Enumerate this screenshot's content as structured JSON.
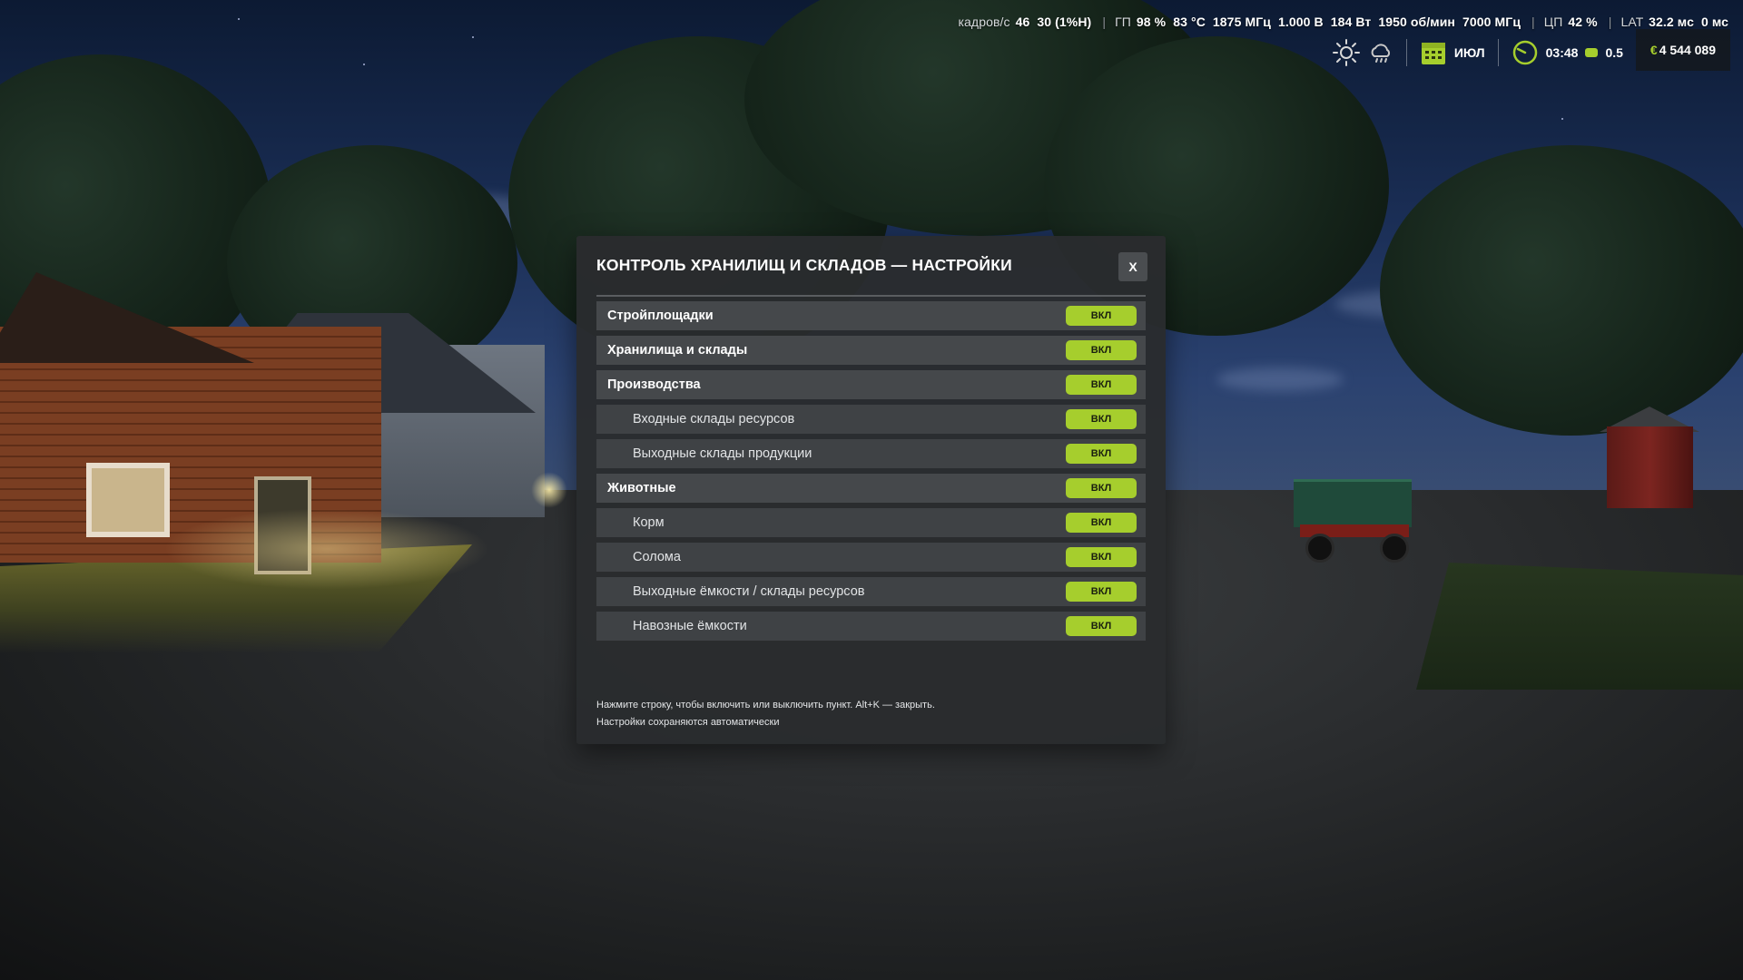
{
  "hud": {
    "stats": {
      "fps_label": "кадров/с",
      "fps_value": "46",
      "fps_limit": "30 (1%Н)",
      "gpu_label": "ГП",
      "gpu_load": "98 %",
      "gpu_temp": "83 °C",
      "gpu_clock": "1875 МГц",
      "gpu_voltage": "1.000 В",
      "gpu_power": "184 Вт",
      "gpu_fan": "1950 об/мин",
      "gpu_mem_clock": "7000 МГц",
      "cpu_label": "ЦП",
      "cpu_load": "42 %",
      "lat_label": "LAT",
      "lat_value": "32.2 мс",
      "lat_extra": "0 мс"
    },
    "month": "ИЮЛ",
    "time": "03:48",
    "time_scale": "0.5",
    "money_symbol": "€",
    "money": "4 544 089",
    "colors": {
      "accent": "#a6ce2d"
    }
  },
  "dialog": {
    "title": "КОНТРОЛЬ ХРАНИЛИЩ И СКЛАДОВ — НАСТРОЙКИ",
    "close_label": "X",
    "rows": [
      {
        "label": "Стройплощадки",
        "level": "main",
        "toggle": "ВКЛ"
      },
      {
        "label": "Хранилища и склады",
        "level": "main",
        "toggle": "ВКЛ"
      },
      {
        "label": "Производства",
        "level": "main",
        "toggle": "ВКЛ"
      },
      {
        "label": "Входные склады ресурсов",
        "level": "sub",
        "toggle": "ВКЛ"
      },
      {
        "label": "Выходные склады продукции",
        "level": "sub",
        "toggle": "ВКЛ"
      },
      {
        "label": "Животные",
        "level": "main",
        "toggle": "ВКЛ"
      },
      {
        "label": "Корм",
        "level": "sub",
        "toggle": "ВКЛ"
      },
      {
        "label": "Солома",
        "level": "sub",
        "toggle": "ВКЛ"
      },
      {
        "label": "Выходные ёмкости / склады ресурсов",
        "level": "sub",
        "toggle": "ВКЛ"
      },
      {
        "label": "Навозные ёмкости",
        "level": "sub",
        "toggle": "ВКЛ"
      }
    ],
    "footer_line1": "Нажмите строку, чтобы включить или выключить пункт. Alt+K — закрыть.",
    "footer_line2": "Настройки сохраняются автоматически"
  }
}
